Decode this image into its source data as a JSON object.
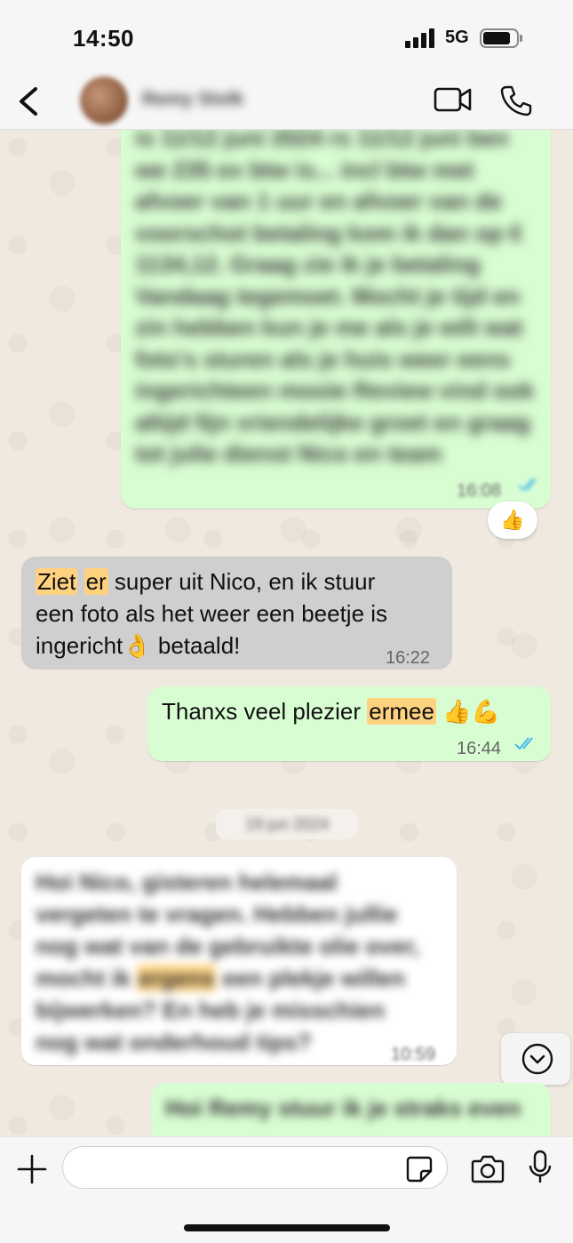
{
  "status_bar": {
    "time": "14:50",
    "network": "5G"
  },
  "header": {
    "contact_name": "Remy Stolk"
  },
  "messages": [
    {
      "id": "m1",
      "direction": "outgoing",
      "blurred": true,
      "text": "is 11/12 juni 2024 rs 11/12 juni ben we 235 ex btw is... incl btw met afvoer van 1 uur en afvoer van de voorschot betaling kom ik dan op € 1134,12. Graag zie ik je betaling Vandaag tegemoet. Mocht je tijd en zin hebben kun je me als je wilt wat foto's sturen als je huis weer eens ingerichteen mooie Review vind ook altijd fijn vriendelijke groet en graag tot julie dienst Nico en team",
      "time": "16:08",
      "reaction": "👍"
    },
    {
      "id": "m2",
      "direction": "incoming",
      "highlight_1": "Ziet",
      "highlight_2": "er",
      "line1_rest": " super uit Nico, en ik stuur",
      "line2": "een foto als het weer een beetje is",
      "line3": "ingericht👌 betaald!",
      "time": "16:22"
    },
    {
      "id": "m3",
      "direction": "outgoing",
      "text_before": "Thanxs veel plezier ",
      "highlight": "ermee",
      "emoji": " 👍💪",
      "time": "16:44"
    },
    {
      "id": "m4",
      "direction": "incoming",
      "blurred": true,
      "line1": "Hoi Nico, gisteren helemaal",
      "line2": "vergeten te vragen. Hebben jullie",
      "line3": "nog wat van de gebruikte olie over,",
      "line4_before": "mocht ik ",
      "line4_highlight": "ergens",
      "line4_after": " een plekje willen",
      "line5": "bijwerken? En heb je misschien",
      "line6": "nog wat onderhoud tips?",
      "time": "10:59"
    },
    {
      "id": "m5",
      "direction": "outgoing",
      "blurred": true,
      "text": "Hoi Remy stuur ik je straks even"
    }
  ],
  "date_chip": "19 jun 2024",
  "composer": {
    "placeholder": ""
  },
  "colors": {
    "outgoing": "#d9fdd3",
    "incoming_selected": "#cfcfcf",
    "incoming": "#ffffff",
    "read_ticks": "#53bdeb",
    "highlight": "#ffd27f"
  },
  "icons": [
    "back-arrow-icon",
    "video-call-icon",
    "phone-icon",
    "thumbs-up-icon",
    "chevron-down-icon",
    "plus-icon",
    "sticker-icon",
    "camera-icon",
    "microphone-icon"
  ]
}
